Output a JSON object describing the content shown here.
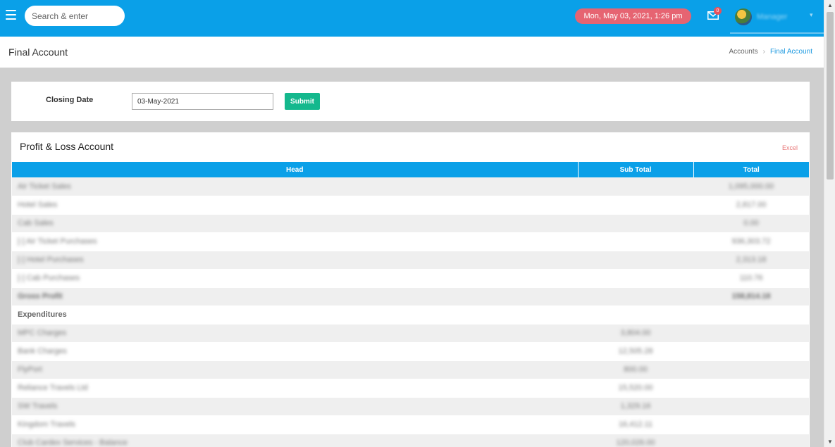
{
  "topbar": {
    "search_placeholder": "Search & enter",
    "datetime": "Mon, May 03, 2021, 1:26 pm",
    "mail_count": "0",
    "username": "Manager"
  },
  "header": {
    "title": "Final Account",
    "breadcrumb": [
      "Accounts",
      "Final Account"
    ]
  },
  "filter": {
    "label": "Closing Date",
    "date_value": "03-May-2021",
    "submit_label": "Submit"
  },
  "report": {
    "title": "Profit & Loss Account",
    "excel_label": "Excel",
    "columns": [
      "Head",
      "Sub Total",
      "Total"
    ],
    "rows": [
      {
        "head": "Air Ticket Sales",
        "sub": "",
        "total": "1,095,000.00"
      },
      {
        "head": "Hotel Sales",
        "sub": "",
        "total": "2,817.00"
      },
      {
        "head": "Cab Sales",
        "sub": "",
        "total": "0.00"
      },
      {
        "head": "[-] Air Ticket Purchases",
        "sub": "",
        "total": "936,303.72"
      },
      {
        "head": "[-] Hotel Purchases",
        "sub": "",
        "total": "2,313.18"
      },
      {
        "head": "[-] Cab Purchases",
        "sub": "",
        "total": "110.76"
      },
      {
        "head": "Gross Profit",
        "sub": "",
        "total": "158,814.18"
      },
      {
        "head": "Expenditures",
        "sub": "",
        "total": ""
      },
      {
        "head": "MPC Charges",
        "sub": "3,804.00",
        "total": ""
      },
      {
        "head": "Bank Charges",
        "sub": "12,505.28",
        "total": ""
      },
      {
        "head": "FlyPort",
        "sub": "800.00",
        "total": ""
      },
      {
        "head": "Reliance Travels Ltd",
        "sub": "15,520.00",
        "total": ""
      },
      {
        "head": "SW Travels",
        "sub": "1,329.16",
        "total": ""
      },
      {
        "head": "Kingdom Travels",
        "sub": "16,412.11",
        "total": ""
      },
      {
        "head": "Club Cardex Services - Balance",
        "sub": "120,026.00",
        "total": ""
      }
    ]
  }
}
